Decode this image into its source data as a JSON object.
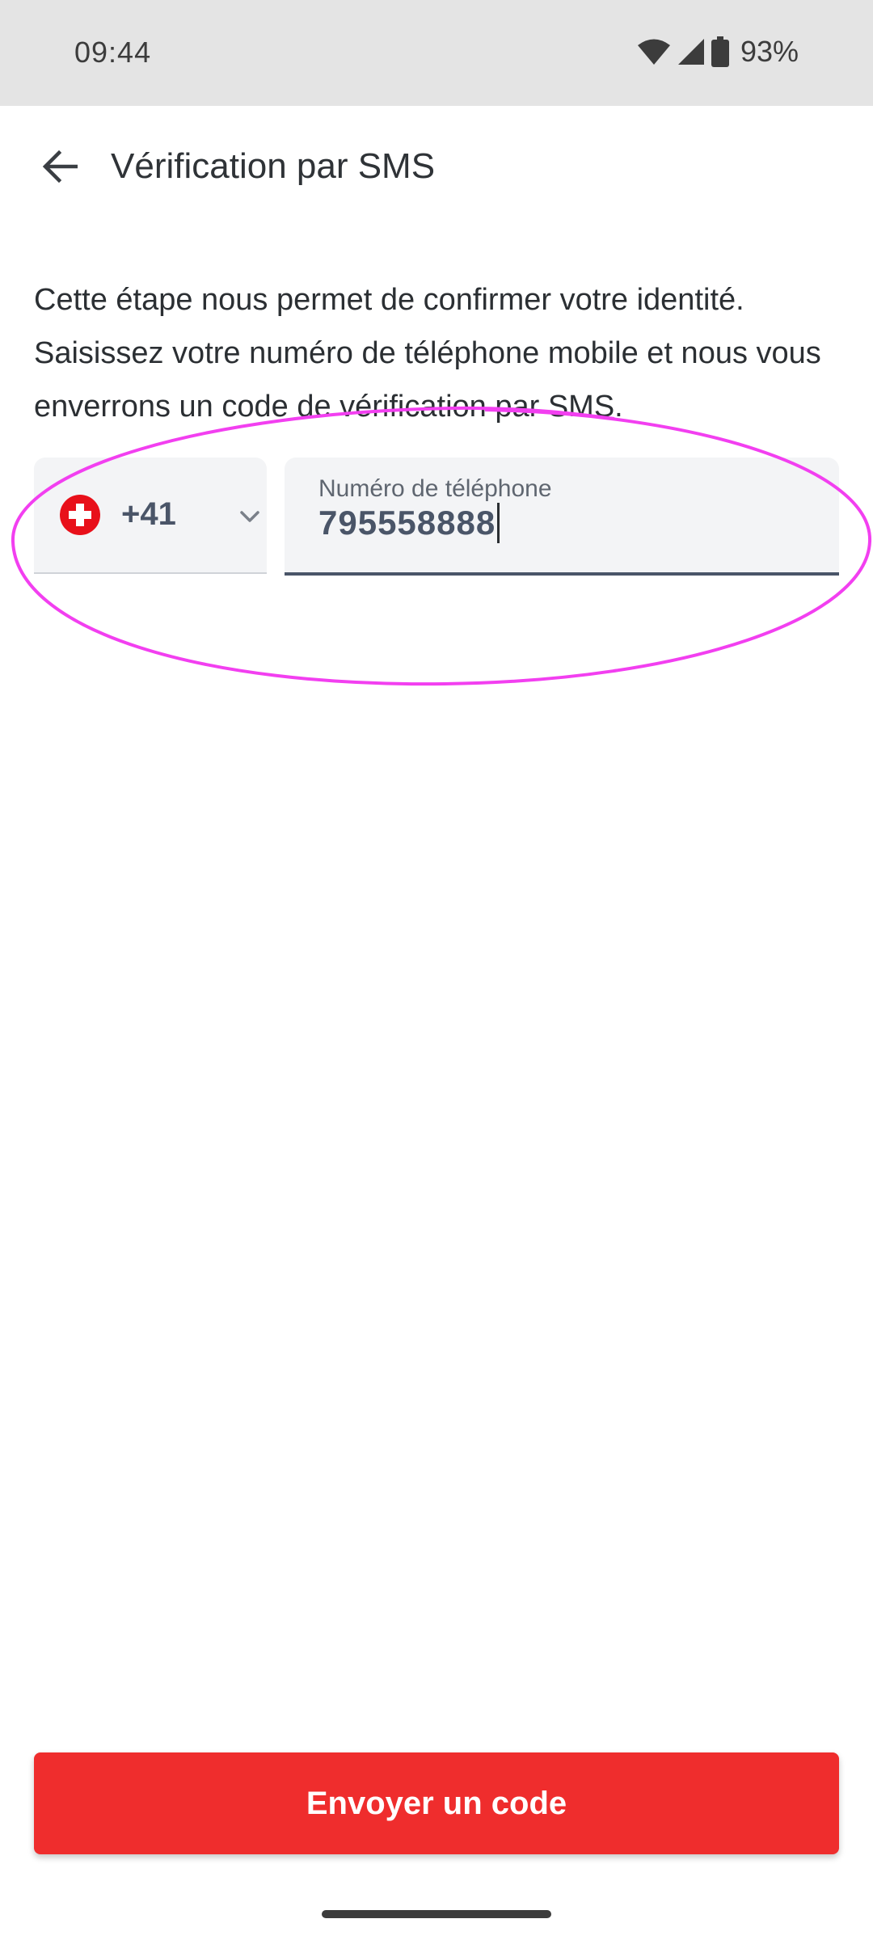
{
  "status_bar": {
    "time": "09:44",
    "battery": "93%",
    "icons": [
      "wifi-icon",
      "signal-icon",
      "battery-icon"
    ]
  },
  "app_bar": {
    "back_icon": "arrow-left-icon",
    "title": "Vérification par SMS"
  },
  "description": "Cette étape nous permet de confirmer votre identité. Saisissez votre numéro de téléphone mobile et nous vous enverrons un code de vérification par SMS.",
  "country_selector": {
    "flag_icon": "swiss-flag-icon",
    "dial_code": "+41",
    "chevron_icon": "chevron-down-icon"
  },
  "phone_field": {
    "label": "Numéro de téléphone",
    "value": "795558888"
  },
  "send_button": {
    "label": "Envoyer un code"
  },
  "colors": {
    "primary": "#ef2d2d",
    "annotation": "#f23ff0",
    "field_bg": "#f3f4f6",
    "field_text": "#4a5568"
  }
}
